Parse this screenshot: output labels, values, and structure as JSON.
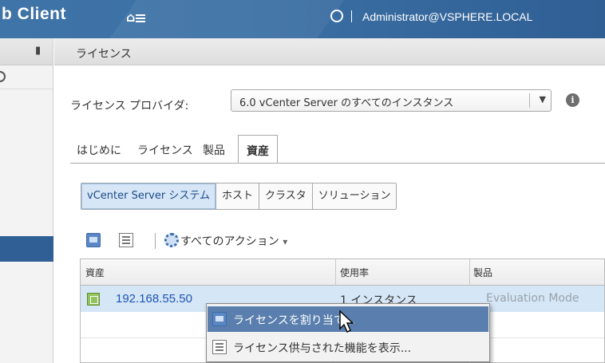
{
  "topbar": {
    "app_title": "b Client",
    "home_icon": "home-menu-icon",
    "refresh_icon": "refresh-icon",
    "separator": "|",
    "user": "Administrator@VSPHERE.LOCAL"
  },
  "navigator": {
    "pin_icon": "pin-icon"
  },
  "page": {
    "title": "ライセンス"
  },
  "provider": {
    "label": "ライセンス プロバイダ:",
    "selected": "6.0 vCenter Server のすべてのインスタンス",
    "info_icon": "info-icon"
  },
  "tabs": [
    {
      "label": "はじめに"
    },
    {
      "label": "ライセンス"
    },
    {
      "label": "製品"
    },
    {
      "label": "資産",
      "active": true
    }
  ],
  "asset_types": [
    {
      "label": "vCenter Server システム",
      "selected": true
    },
    {
      "label": "ホスト"
    },
    {
      "label": "クラスタ"
    },
    {
      "label": "ソリューション"
    }
  ],
  "toolbar": {
    "actions_label": "すべてのアクション",
    "actions_dropdown_glyph": "▾"
  },
  "table": {
    "columns": [
      "資産",
      "使用率",
      "製品"
    ],
    "rows": [
      {
        "asset": "192.168.55.50",
        "usage": "1 インスタンス",
        "product": "Evaluation Mode"
      }
    ]
  },
  "context_menu": {
    "items": [
      {
        "label": "ライセンスを割り当て...",
        "icon": "assign-license-icon",
        "highlighted": true
      },
      {
        "label": "ライセンス供与された機能を表示...",
        "icon": "feature-list-icon"
      }
    ]
  },
  "colors": {
    "topbar": "#3b6fa4",
    "selection": "#d5e6f6",
    "menu_highlight": "#5a7fae",
    "link": "#1d55b3"
  }
}
